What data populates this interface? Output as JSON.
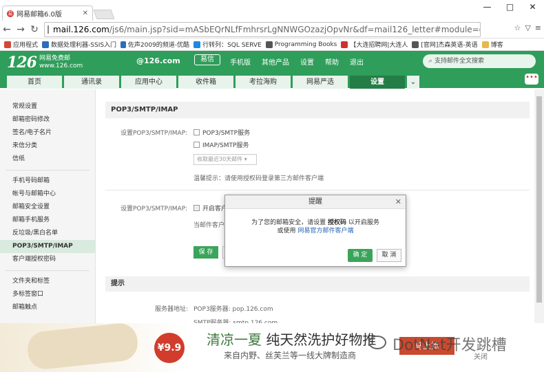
{
  "browser": {
    "tab_title": "网易邮箱6.0版",
    "favicon_letter": "易",
    "url_domain": "mail.126.com",
    "url_path": "/js6/main.jsp?sid=mASbEQrNLfFmhrsrLgNNWGOzazjOpvNr&df=mail126_letter#module=options.Link",
    "window_controls": {
      "minimize": "—",
      "maximize": "□",
      "close": "✕"
    }
  },
  "bookmarks": [
    {
      "label": "应用程式",
      "color": "#d14836"
    },
    {
      "label": "数据处理利器-SSIS入门",
      "color": "#2a6ebb"
    },
    {
      "label": "佐声2009的频道-优酷",
      "color": "#2a6ebb"
    },
    {
      "label": "行转列：SQL SERVE",
      "color": "#1e88e5"
    },
    {
      "label": "Programming Books",
      "color": "#555555"
    },
    {
      "label": "【大连招聘网|大连人",
      "color": "#d32f2f"
    },
    {
      "label": "[官网]杰森英语-英语",
      "color": "#555555"
    },
    {
      "label": "博客",
      "color": "#e8b84a"
    }
  ],
  "header": {
    "logo_number": "126",
    "logo_text1": "网易免费邮",
    "logo_text2": "www.126.com",
    "account": "@126.com",
    "yixin": "易信",
    "links": [
      "手机版",
      "其他产品",
      "设置",
      "帮助",
      "退出"
    ],
    "search_placeholder": "支持邮件全文搜索"
  },
  "nav_tabs": [
    "首页",
    "通讯录",
    "应用中心",
    "收件箱",
    "考拉海购",
    "网易严选",
    "设置"
  ],
  "sidebar": {
    "group1": [
      "常规设置",
      "邮箱密码修改",
      "签名/电子名片",
      "来信分类",
      "信纸"
    ],
    "group2": [
      "手机号码邮箱",
      "帐号与邮箱中心",
      "邮箱安全设置",
      "邮箱手机服务",
      "反垃圾/黑白名单",
      "POP3/SMTP/IMAP",
      "客户端授权密码"
    ],
    "group3": [
      "文件夹和标签",
      "多标签窗口",
      "邮箱触点"
    ]
  },
  "main": {
    "section_title": "POP3/SMTP/IMAP",
    "setting_label": "设置POP3/SMTP/IMAP:",
    "pop3_service": "POP3/SMTP服务",
    "imap_service": "IMAP/SMTP服务",
    "select_value": "收取最近30天邮件",
    "hint": "温馨提示：请使用授权码登录第三方邮件客户端",
    "setting_label2": "设置POP3/SMTP/IMAP:",
    "open_client": "开启客户端删除邮件提醒",
    "note_prefix": "当邮件客户端删除邮件时",
    "save_button": "保 存",
    "tips_title": "提示",
    "server_label": "服务器地址:",
    "pop3_server": "POP3服务器: pop.126.com",
    "smtp_server": "SMTP服务器: smtp.126.com"
  },
  "dialog": {
    "title": "提醒",
    "line1_prefix": "为了您的邮箱安全，请设置",
    "line1_key": "授权码",
    "line1_suffix": "以开启服务",
    "line2_prefix": "或使用",
    "line2_link": "网易官方邮件客户端",
    "ok": "确 定",
    "cancel": "取 消"
  },
  "ad": {
    "price": "¥9.9起",
    "headline_green": "清凉一夏",
    "headline_dark": "纯天然洗护好物推",
    "subline": "来自内野、丝芙兰等一线大牌制造商",
    "button": "马上抢",
    "close": "关闭",
    "watermark": "DotNet开发跳槽"
  }
}
